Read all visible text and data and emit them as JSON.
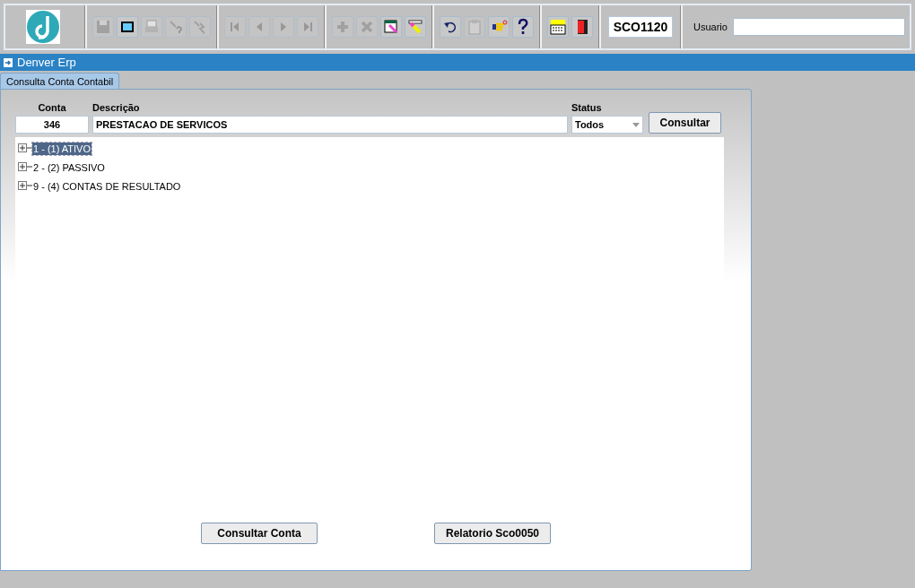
{
  "toolbar": {
    "groups": [
      [
        {
          "kind": "save",
          "disabled": true
        },
        {
          "kind": "window",
          "disabled": false
        },
        {
          "kind": "print",
          "disabled": true
        },
        {
          "kind": "query",
          "disabled": true
        },
        {
          "kind": "execute",
          "disabled": true
        }
      ],
      [
        {
          "kind": "first",
          "disabled": true
        },
        {
          "kind": "prev",
          "disabled": true
        },
        {
          "kind": "next",
          "disabled": true
        },
        {
          "kind": "last",
          "disabled": true
        }
      ],
      [
        {
          "kind": "add",
          "disabled": true
        },
        {
          "kind": "delete",
          "disabled": true
        },
        {
          "kind": "edit-window",
          "disabled": false
        },
        {
          "kind": "edit",
          "disabled": false
        }
      ],
      [
        {
          "kind": "undo",
          "disabled": false
        },
        {
          "kind": "clipboard",
          "disabled": true
        },
        {
          "kind": "hand",
          "disabled": false
        },
        {
          "kind": "help",
          "disabled": false
        }
      ],
      [
        {
          "kind": "menu",
          "disabled": false
        },
        {
          "kind": "exit",
          "disabled": false
        }
      ]
    ],
    "form_code": "SCO1120",
    "user_label": "Usuario"
  },
  "window": {
    "title": "Denver Erp"
  },
  "tabs": [
    {
      "label": "Consulta Conta Contabil",
      "selected": true
    }
  ],
  "filters": {
    "conta_label": "Conta",
    "conta_value": "346",
    "descricao_label": "Descrição",
    "descricao_value": "PRESTACAO DE SERVICOS",
    "status_label": "Status",
    "status_value": "Todos",
    "search_button": "Consultar"
  },
  "tree": [
    {
      "label": "1 - (1) ATIVO",
      "selected": true,
      "expanded": false
    },
    {
      "label": "2 - (2) PASSIVO",
      "selected": false,
      "expanded": false
    },
    {
      "label": "9 - (4) CONTAS DE RESULTADO",
      "selected": false,
      "expanded": false
    }
  ],
  "buttons": [
    "Consultar Conta",
    "Relatorio Sco0050"
  ]
}
